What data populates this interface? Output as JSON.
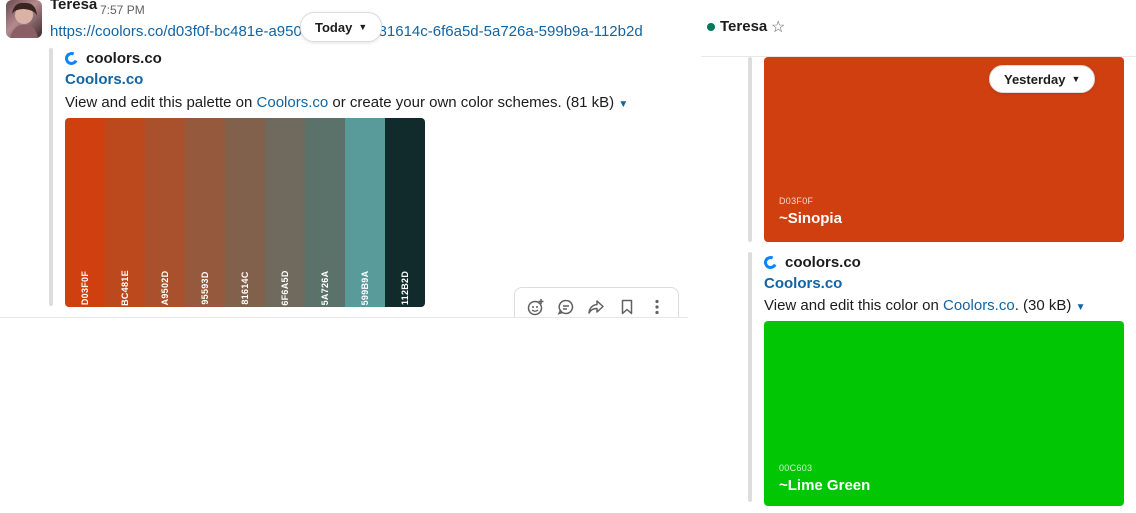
{
  "left_message": {
    "sender": "Teresa",
    "time": "7:57 PM",
    "url": "https://coolors.co/d03f0f-bc481e-a9502d-95593d-81614c-6f6a5d-5a726a-599b9a-112b2d",
    "date_pill": "Today",
    "attachment": {
      "site": "coolors.co",
      "title": "Coolors.co",
      "desc_prefix": "View and edit this palette on ",
      "desc_link": "Coolors.co",
      "desc_suffix": " or create your own color schemes. (81 kB)",
      "palette": [
        {
          "hex": "D03F0F",
          "color": "#d03f0f"
        },
        {
          "hex": "BC481E",
          "color": "#bc481e"
        },
        {
          "hex": "A9502D",
          "color": "#a9502d"
        },
        {
          "hex": "95593D",
          "color": "#95593d"
        },
        {
          "hex": "81614C",
          "color": "#81614c"
        },
        {
          "hex": "6F6A5D",
          "color": "#6f6a5d"
        },
        {
          "hex": "5A726A",
          "color": "#5a726a"
        },
        {
          "hex": "599B9A",
          "color": "#599b9a"
        },
        {
          "hex": "112B2D",
          "color": "#112b2d"
        }
      ]
    },
    "toolbar_icons": [
      "add-reaction-icon",
      "reply-thread-icon",
      "share-icon",
      "bookmark-icon",
      "more-actions-icon"
    ]
  },
  "right_pane": {
    "header": {
      "name": "Teresa",
      "star_icon": "star-icon"
    },
    "date_pill": "Yesterday",
    "card1": {
      "hex": "D03F0F",
      "name": "~Sinopia",
      "color": "#d03f0f"
    },
    "attachment": {
      "site": "coolors.co",
      "title": "Coolors.co",
      "desc_prefix": "View and edit this color on ",
      "desc_link": "Coolors.co",
      "desc_suffix": ". (30 kB)"
    },
    "card2": {
      "hex": "00C603",
      "name": "~Lime Green",
      "color": "#00c603"
    }
  }
}
